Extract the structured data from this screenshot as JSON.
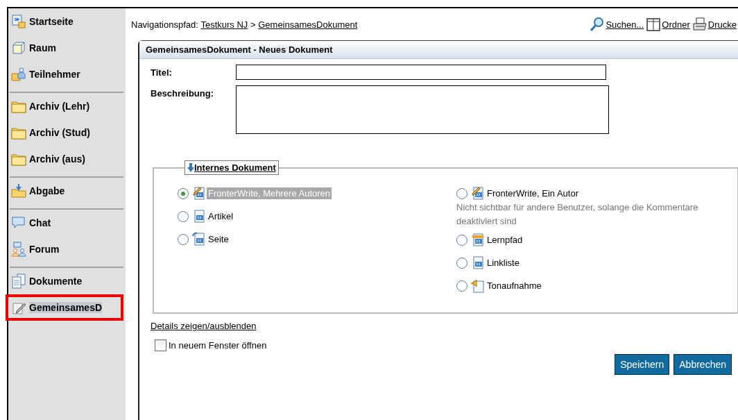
{
  "sidebar": {
    "groups": [
      [
        {
          "label": "Startseite",
          "kind": "home",
          "selected": false
        },
        {
          "label": "Raum",
          "kind": "room",
          "selected": false
        },
        {
          "label": "Teilnehmer",
          "kind": "people",
          "selected": false
        }
      ],
      [
        {
          "label": "Archiv (Lehr)",
          "kind": "folder",
          "selected": false
        },
        {
          "label": "Archiv (Stud)",
          "kind": "folder",
          "selected": false
        },
        {
          "label": "Archiv (aus)",
          "kind": "folder",
          "selected": false
        }
      ],
      [
        {
          "label": "Abgabe",
          "kind": "inbox",
          "selected": false
        }
      ],
      [
        {
          "label": "Chat",
          "kind": "chat",
          "selected": false
        },
        {
          "label": "Forum",
          "kind": "forum",
          "selected": false
        }
      ],
      [
        {
          "label": "Dokumente",
          "kind": "documents",
          "selected": false
        },
        {
          "label": "GemeinsamesD",
          "kind": "pen",
          "selected": true
        }
      ]
    ]
  },
  "breadcrumb": {
    "label": "Navigationspfad:",
    "links": [
      "Testkurs NJ",
      "GemeinsamesDokument"
    ],
    "separator": ">"
  },
  "toolbar": [
    {
      "label": "Suchen...",
      "kind": "search"
    },
    {
      "label": "Ordner",
      "kind": "book"
    },
    {
      "label": "Drucke",
      "kind": "print"
    }
  ],
  "panel": {
    "title": "GemeinsamesDokument - Neues Dokument",
    "fields": [
      {
        "label": "Titel:",
        "kind": "input"
      },
      {
        "label": "Beschreibung:",
        "kind": "textarea"
      }
    ],
    "fieldset": {
      "legend": "Internes Dokument",
      "columns": [
        [
          {
            "label": "FronterWrite, Mehrere Autoren",
            "kind": "pen",
            "selected": true
          },
          {
            "label": "Artikel",
            "kind": "doc",
            "selected": false
          },
          {
            "label": "Seite",
            "kind": "page",
            "selected": false
          }
        ],
        [
          {
            "label": "FronterWrite, Ein Autor",
            "kind": "pen",
            "selected": false,
            "note": "Nicht sichtbar für andere Benutzer, solange die Kommentare deaktiviert sind"
          },
          {
            "label": "Lernpfad",
            "kind": "path",
            "selected": false
          },
          {
            "label": "Linkliste",
            "kind": "doc",
            "selected": false
          },
          {
            "label": "Tonaufnahme",
            "kind": "sound",
            "selected": false
          }
        ]
      ]
    },
    "details_link": "Details zeigen/ausblenden",
    "new_window": {
      "label": "In neuem Fenster öffnen",
      "checked": false
    },
    "buttons": [
      "Speichern",
      "Abbrechen"
    ]
  }
}
